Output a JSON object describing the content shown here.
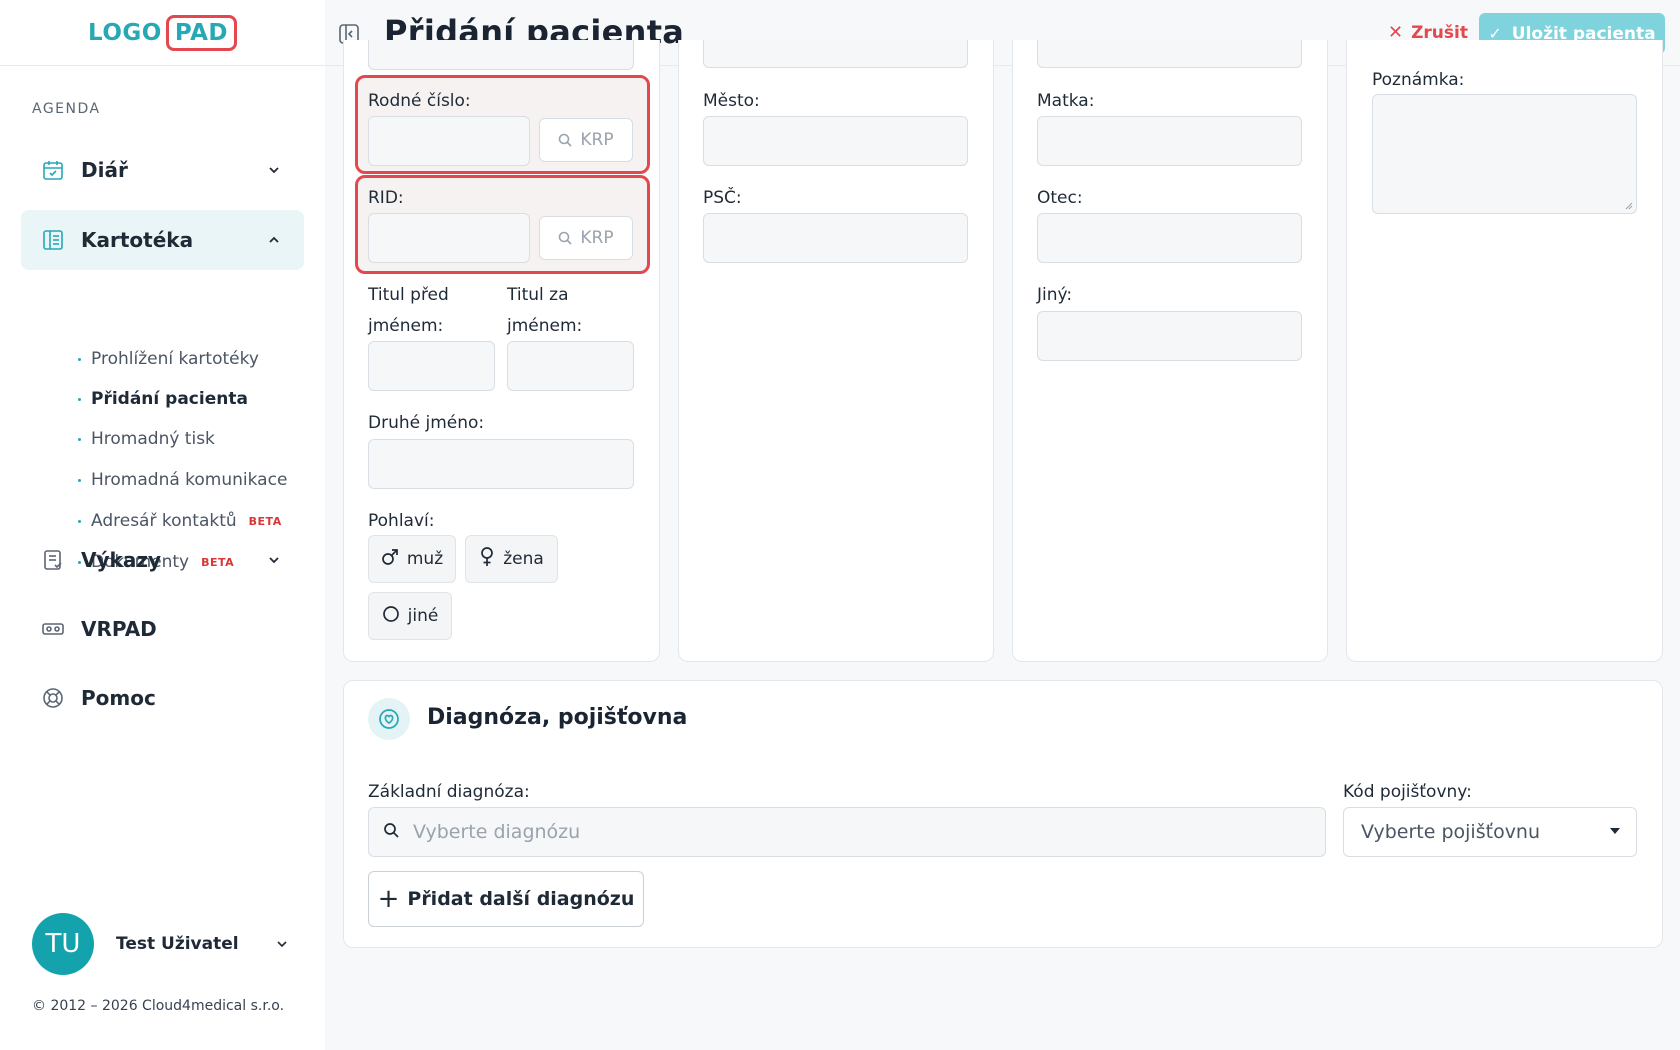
{
  "logo": {
    "left": "LOGO",
    "right": "PAD"
  },
  "sidebar": {
    "section": "AGENDA",
    "items": [
      {
        "label": "Diář"
      },
      {
        "label": "Kartotéka"
      },
      {
        "label": "Výkazy"
      },
      {
        "label": "VRPAD"
      },
      {
        "label": "Pomoc"
      }
    ],
    "sub_items": [
      {
        "label": "Prohlížení kartotéky"
      },
      {
        "label": "Přidání pacienta"
      },
      {
        "label": "Hromadný tisk"
      },
      {
        "label": "Hromadná komunikace"
      },
      {
        "label": "Adresář kontaktů",
        "badge": "BETA"
      },
      {
        "label": "Dokumenty",
        "badge": "BETA"
      }
    ]
  },
  "user": {
    "initials": "TU",
    "name": "Test Uživatel"
  },
  "copyright": "© 2012 – 2026 Cloud4medical s.r.o.",
  "header": {
    "title": "Přidání pacienta",
    "cancel_label": "Zrušit",
    "save_label": "Uložit pacienta"
  },
  "form": {
    "col1": {
      "birth_number_label": "Rodné číslo:",
      "krp_label": "KRP",
      "rid_label": "RID:",
      "title_before_label_1": "Titul před",
      "title_before_label_2": "jménem:",
      "title_after_label_1": "Titul za",
      "title_after_label_2": "jménem:",
      "middle_name_label": "Druhé jméno:",
      "gender_label": "Pohlaví:",
      "gender_options": [
        "muž",
        "žena",
        "jiné"
      ]
    },
    "col2": {
      "city_label": "Město:",
      "zip_label": "PSČ:"
    },
    "col3": {
      "mother_label": "Matka:",
      "father_label": "Otec:",
      "other_label": "Jiný:"
    },
    "col4": {
      "note_label": "Poznámka:"
    }
  },
  "diagnosis": {
    "title": "Diagnóza, pojišťovna",
    "basic_label": "Základní diagnóza:",
    "basic_placeholder": "Vyberte diagnózu",
    "insurance_label": "Kód pojišťovny:",
    "insurance_value": "Vyberte pojišťovnu",
    "add_label": "Přidat další diagnózu"
  },
  "colors": {
    "accent": "#27a9b5",
    "danger": "#e2484d",
    "save_disabled": "#7fd3dc"
  }
}
